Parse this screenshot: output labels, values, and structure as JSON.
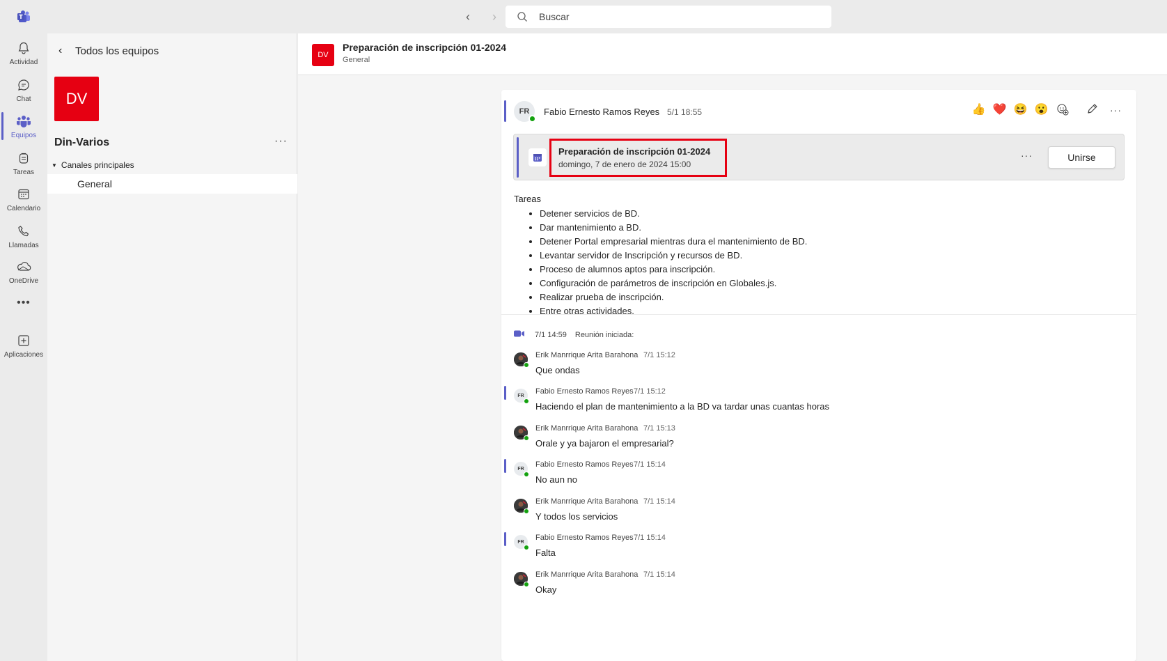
{
  "app": {
    "search_placeholder": "Buscar",
    "accent_color": "#5b5fc7",
    "team_color": "#e60012"
  },
  "rail": {
    "items": [
      {
        "label": "Actividad",
        "icon": "bell-icon"
      },
      {
        "label": "Chat",
        "icon": "chat-icon"
      },
      {
        "label": "Equipos",
        "icon": "teams-icon",
        "active": true
      },
      {
        "label": "Tareas",
        "icon": "tasks-icon"
      },
      {
        "label": "Calendario",
        "icon": "calendar-icon"
      },
      {
        "label": "Llamadas",
        "icon": "phone-icon"
      },
      {
        "label": "OneDrive",
        "icon": "cloud-icon"
      },
      {
        "label": "",
        "icon": "more-icon"
      },
      {
        "label": "Aplicaciones",
        "icon": "add-app-icon"
      }
    ]
  },
  "left_panel": {
    "back_label": "Todos los equipos",
    "team_initials": "DV",
    "team_name": "Din-Varios",
    "more": "···",
    "section_label": "Canales principales",
    "channel": "General"
  },
  "header": {
    "avatar": "DV",
    "title": "Preparación de inscripción 01-2024",
    "subtitle": "General"
  },
  "post": {
    "avatar": "FR",
    "author": "Fabio Ernesto Ramos Reyes",
    "time": "5/1 18:55",
    "meeting": {
      "title": "Preparación de inscripción 01-2024",
      "date": "domingo, 7 de enero de 2024 15:00",
      "more": "···",
      "join_label": "Unirse"
    },
    "tasks_title": "Tareas",
    "tasks": [
      "Detener servicios de BD.",
      "Dar mantenimiento a BD.",
      "Detener Portal empresarial mientras dura el mantenimiento de BD.",
      "Levantar servidor de Inscripción y recursos de BD.",
      "Proceso de alumnos aptos para inscripción.",
      "Configuración de parámetros de inscripción en Globales.js.",
      "Realizar prueba de inscripción.",
      "Entre otras actividades."
    ],
    "meeting_started": {
      "time": "7/1 14:59",
      "label": "Reunión iniciada:"
    },
    "replies": [
      {
        "author": "Erik Manrrique Arita Barahona",
        "time": "7/1 15:12",
        "text": "Que ondas",
        "avatar": ""
      },
      {
        "author": "Fabio Ernesto Ramos Reyes",
        "time": "7/1 15:12",
        "text": "Haciendo el plan de mantenimiento a la BD va tardar unas cuantas horas",
        "avatar": "FR"
      },
      {
        "author": "Erik Manrrique Arita Barahona",
        "time": "7/1 15:13",
        "text": "Orale y ya bajaron el empresarial?",
        "avatar": ""
      },
      {
        "author": "Fabio Ernesto Ramos Reyes",
        "time": "7/1 15:14",
        "text": "No aun no",
        "avatar": "FR"
      },
      {
        "author": "Erik Manrrique Arita Barahona",
        "time": "7/1 15:14",
        "text": "Y todos los servicios",
        "avatar": ""
      },
      {
        "author": "Fabio Ernesto Ramos Reyes",
        "time": "7/1 15:14",
        "text": "Falta",
        "avatar": "FR"
      },
      {
        "author": "Erik Manrrique Arita Barahona",
        "time": "7/1 15:14",
        "text": "Okay",
        "avatar": ""
      }
    ]
  }
}
